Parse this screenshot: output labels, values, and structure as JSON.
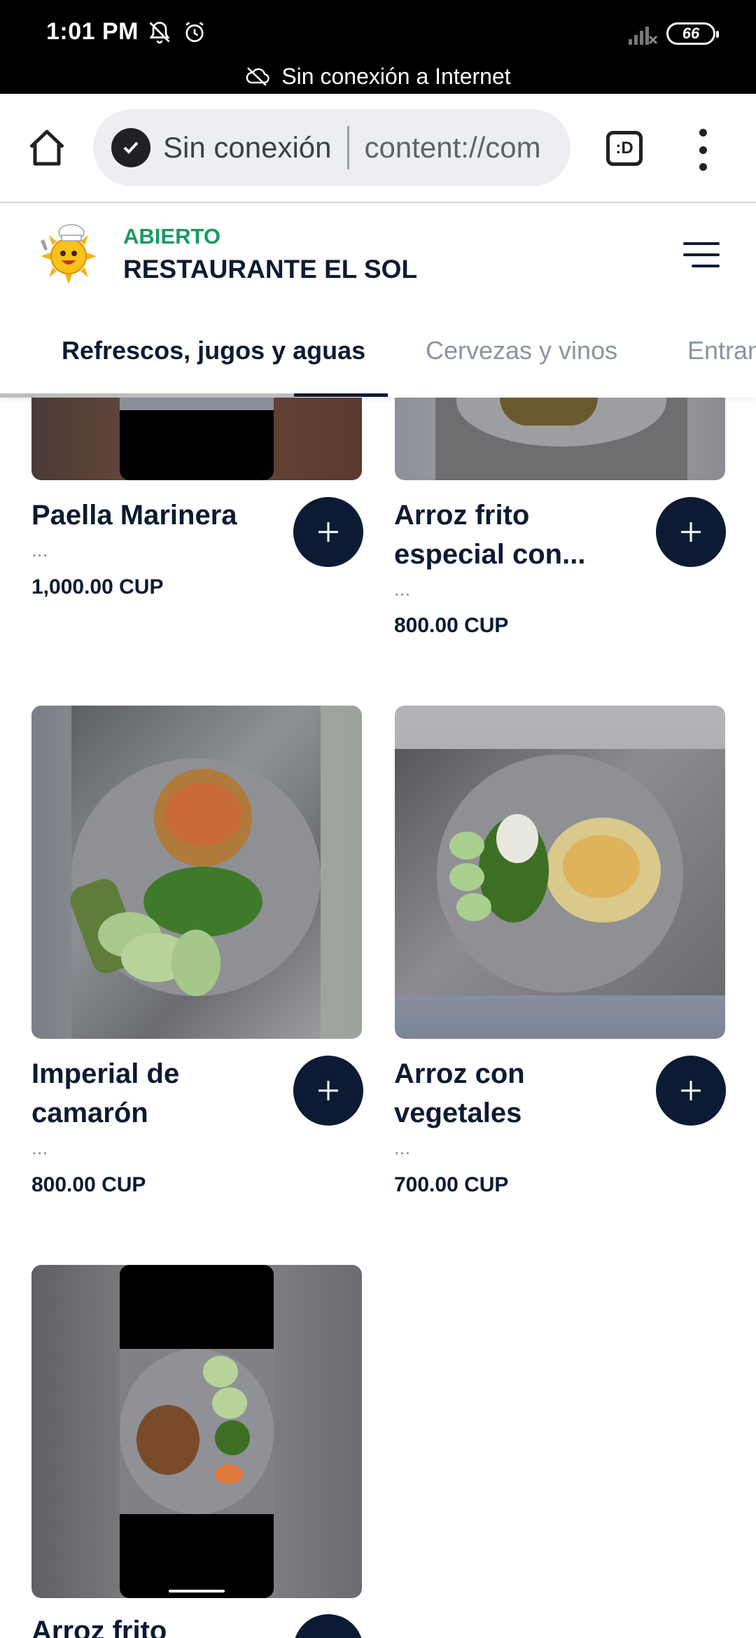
{
  "status_bar": {
    "time": "1:01 PM",
    "battery": "66",
    "offline_message": "Sin conexión a Internet"
  },
  "browser": {
    "connection_status": "Sin conexión",
    "url": "content://com",
    "tabs_glyph": ":D"
  },
  "restaurant": {
    "status": "ABIERTO",
    "name": "RESTAURANTE EL SOL"
  },
  "category_tabs": [
    {
      "label": "Refrescos, jugos y aguas",
      "active": true
    },
    {
      "label": "Cervezas y vinos",
      "active": false
    },
    {
      "label": "Entrantes",
      "active": false
    }
  ],
  "products": [
    {
      "name": "Paella Marinera",
      "description": "...",
      "price": "1,000.00 CUP"
    },
    {
      "name": "Arroz frito especial con...",
      "description": "...",
      "price": "800.00 CUP"
    },
    {
      "name": "Imperial de camarón",
      "description": "...",
      "price": "800.00 CUP"
    },
    {
      "name": "Arroz con vegetales",
      "description": "...",
      "price": "700.00 CUP"
    },
    {
      "name": "Arroz frito",
      "description": "",
      "price": ""
    }
  ],
  "colors": {
    "brand_navy": "#0c1b33",
    "open_green": "#1a9a62",
    "muted_text": "#8a94a3"
  },
  "icons": {
    "home": "home-icon",
    "offline_check": "offline-check-icon",
    "menu": "hamburger-menu-icon",
    "add": "plus-icon"
  }
}
